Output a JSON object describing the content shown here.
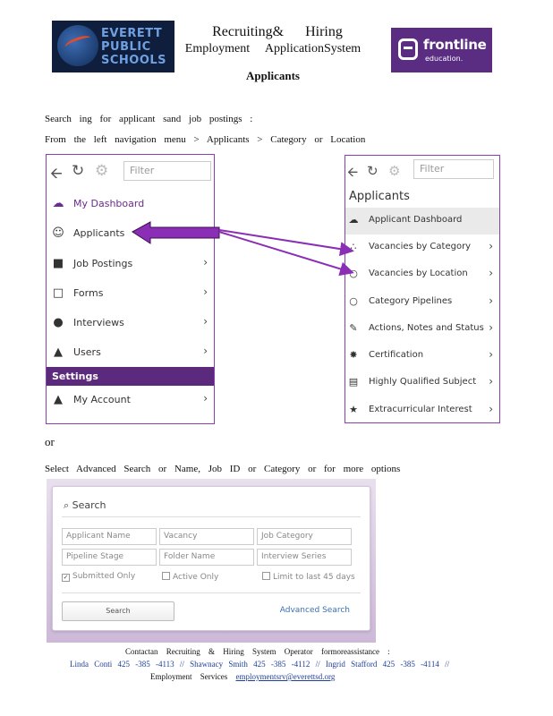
{
  "header": {
    "title_line1": "Recruiting&  Hiring",
    "title_line2": "Employment  ApplicationSystem",
    "page_heading": "Applicants",
    "left_logo_text": [
      "EVERETT",
      "PUBLIC",
      "SCHOOLS"
    ],
    "right_logo_name": "frontline",
    "right_logo_sub": "education."
  },
  "intro": {
    "line1": "Search ing for applicant sand job postings :",
    "line2": "From the left navigation menu > Applicants > Category or Location",
    "or": "or",
    "line3": "Select Advanced Search or Name, Job ID or Category or for more options"
  },
  "left_nav": {
    "filter_placeholder": "Filter",
    "items": [
      {
        "label": "My Dashboard",
        "icon": "cloud-icon"
      },
      {
        "label": "Applicants",
        "icon": "users-icon"
      },
      {
        "label": "Job Postings",
        "icon": "file-icon"
      },
      {
        "label": "Forms",
        "icon": "file-outline-icon"
      },
      {
        "label": "Interviews",
        "icon": "chat-icon"
      },
      {
        "label": "Users",
        "icon": "user-icon"
      }
    ],
    "settings_label": "Settings",
    "account_label": "My Account",
    "chevron": "›"
  },
  "right_nav": {
    "filter_placeholder": "Filter",
    "heading": "Applicants",
    "items": [
      {
        "label": "Applicant Dashboard",
        "icon": "cloud-icon"
      },
      {
        "label": "Vacancies by Category",
        "icon": "sitemap-icon"
      },
      {
        "label": "Vacancies by Location",
        "icon": "map-pin-icon"
      },
      {
        "label": "Category Pipelines",
        "icon": "circle-icon"
      },
      {
        "label": "Actions, Notes and Status",
        "icon": "pencil-icon"
      },
      {
        "label": "Certification",
        "icon": "badge-icon"
      },
      {
        "label": "Highly Qualified Subject",
        "icon": "book-icon"
      },
      {
        "label": "Extracurricular Interest",
        "icon": "star-icon"
      }
    ],
    "chevron": "›"
  },
  "search_panel": {
    "title": "Search",
    "fields_row1": [
      "Applicant Name",
      "Vacancy",
      "Job Category"
    ],
    "fields_row2": [
      "Pipeline Stage",
      "Folder Name",
      "Interview Series"
    ],
    "checkboxes": [
      {
        "label": "Submitted Only",
        "checked": true
      },
      {
        "label": "Active Only",
        "checked": false
      },
      {
        "label": "Limit to last 45 days",
        "checked": false
      }
    ],
    "button_label": "Search",
    "advanced_link": "Advanced Search"
  },
  "footer": {
    "line1": "Contactan Recruiting & Hiring System Operator formoreassistance :",
    "contact1": "Linda Conti 425 -385 -4113 //",
    "contact2": "Shawnacy Smith 425 -385 -4112 //",
    "contact3": "Ingrid Stafford 425 -385 -4114 //",
    "line3_prefix": "Employment Services",
    "email": "employmentsrv@everettsd.org"
  },
  "colors": {
    "purple_border": "#8a3fae",
    "settings_bar": "#5c2a7c",
    "arrow": "#8a2fb5",
    "frontline_bg": "#5a2d82"
  }
}
